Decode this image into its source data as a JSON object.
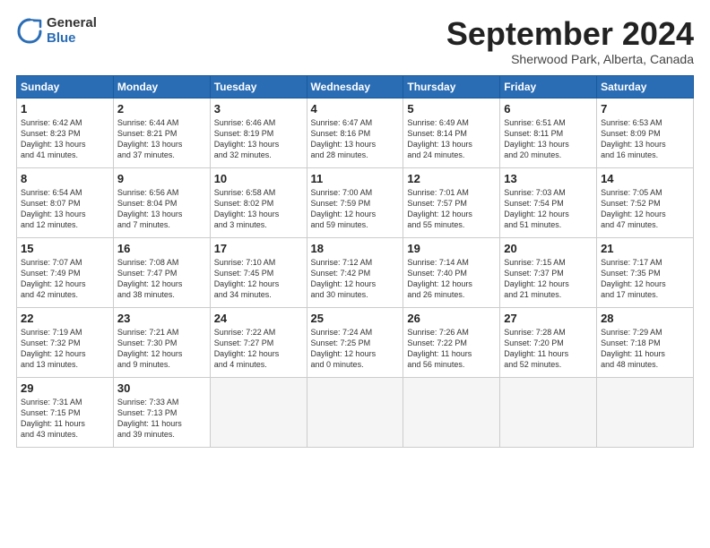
{
  "header": {
    "logo_general": "General",
    "logo_blue": "Blue",
    "month_title": "September 2024",
    "location": "Sherwood Park, Alberta, Canada"
  },
  "days_of_week": [
    "Sunday",
    "Monday",
    "Tuesday",
    "Wednesday",
    "Thursday",
    "Friday",
    "Saturday"
  ],
  "weeks": [
    [
      {
        "day": "1",
        "info": "Sunrise: 6:42 AM\nSunset: 8:23 PM\nDaylight: 13 hours\nand 41 minutes."
      },
      {
        "day": "2",
        "info": "Sunrise: 6:44 AM\nSunset: 8:21 PM\nDaylight: 13 hours\nand 37 minutes."
      },
      {
        "day": "3",
        "info": "Sunrise: 6:46 AM\nSunset: 8:19 PM\nDaylight: 13 hours\nand 32 minutes."
      },
      {
        "day": "4",
        "info": "Sunrise: 6:47 AM\nSunset: 8:16 PM\nDaylight: 13 hours\nand 28 minutes."
      },
      {
        "day": "5",
        "info": "Sunrise: 6:49 AM\nSunset: 8:14 PM\nDaylight: 13 hours\nand 24 minutes."
      },
      {
        "day": "6",
        "info": "Sunrise: 6:51 AM\nSunset: 8:11 PM\nDaylight: 13 hours\nand 20 minutes."
      },
      {
        "day": "7",
        "info": "Sunrise: 6:53 AM\nSunset: 8:09 PM\nDaylight: 13 hours\nand 16 minutes."
      }
    ],
    [
      {
        "day": "8",
        "info": "Sunrise: 6:54 AM\nSunset: 8:07 PM\nDaylight: 13 hours\nand 12 minutes."
      },
      {
        "day": "9",
        "info": "Sunrise: 6:56 AM\nSunset: 8:04 PM\nDaylight: 13 hours\nand 7 minutes."
      },
      {
        "day": "10",
        "info": "Sunrise: 6:58 AM\nSunset: 8:02 PM\nDaylight: 13 hours\nand 3 minutes."
      },
      {
        "day": "11",
        "info": "Sunrise: 7:00 AM\nSunset: 7:59 PM\nDaylight: 12 hours\nand 59 minutes."
      },
      {
        "day": "12",
        "info": "Sunrise: 7:01 AM\nSunset: 7:57 PM\nDaylight: 12 hours\nand 55 minutes."
      },
      {
        "day": "13",
        "info": "Sunrise: 7:03 AM\nSunset: 7:54 PM\nDaylight: 12 hours\nand 51 minutes."
      },
      {
        "day": "14",
        "info": "Sunrise: 7:05 AM\nSunset: 7:52 PM\nDaylight: 12 hours\nand 47 minutes."
      }
    ],
    [
      {
        "day": "15",
        "info": "Sunrise: 7:07 AM\nSunset: 7:49 PM\nDaylight: 12 hours\nand 42 minutes."
      },
      {
        "day": "16",
        "info": "Sunrise: 7:08 AM\nSunset: 7:47 PM\nDaylight: 12 hours\nand 38 minutes."
      },
      {
        "day": "17",
        "info": "Sunrise: 7:10 AM\nSunset: 7:45 PM\nDaylight: 12 hours\nand 34 minutes."
      },
      {
        "day": "18",
        "info": "Sunrise: 7:12 AM\nSunset: 7:42 PM\nDaylight: 12 hours\nand 30 minutes."
      },
      {
        "day": "19",
        "info": "Sunrise: 7:14 AM\nSunset: 7:40 PM\nDaylight: 12 hours\nand 26 minutes."
      },
      {
        "day": "20",
        "info": "Sunrise: 7:15 AM\nSunset: 7:37 PM\nDaylight: 12 hours\nand 21 minutes."
      },
      {
        "day": "21",
        "info": "Sunrise: 7:17 AM\nSunset: 7:35 PM\nDaylight: 12 hours\nand 17 minutes."
      }
    ],
    [
      {
        "day": "22",
        "info": "Sunrise: 7:19 AM\nSunset: 7:32 PM\nDaylight: 12 hours\nand 13 minutes."
      },
      {
        "day": "23",
        "info": "Sunrise: 7:21 AM\nSunset: 7:30 PM\nDaylight: 12 hours\nand 9 minutes."
      },
      {
        "day": "24",
        "info": "Sunrise: 7:22 AM\nSunset: 7:27 PM\nDaylight: 12 hours\nand 4 minutes."
      },
      {
        "day": "25",
        "info": "Sunrise: 7:24 AM\nSunset: 7:25 PM\nDaylight: 12 hours\nand 0 minutes."
      },
      {
        "day": "26",
        "info": "Sunrise: 7:26 AM\nSunset: 7:22 PM\nDaylight: 11 hours\nand 56 minutes."
      },
      {
        "day": "27",
        "info": "Sunrise: 7:28 AM\nSunset: 7:20 PM\nDaylight: 11 hours\nand 52 minutes."
      },
      {
        "day": "28",
        "info": "Sunrise: 7:29 AM\nSunset: 7:18 PM\nDaylight: 11 hours\nand 48 minutes."
      }
    ],
    [
      {
        "day": "29",
        "info": "Sunrise: 7:31 AM\nSunset: 7:15 PM\nDaylight: 11 hours\nand 43 minutes."
      },
      {
        "day": "30",
        "info": "Sunrise: 7:33 AM\nSunset: 7:13 PM\nDaylight: 11 hours\nand 39 minutes."
      },
      {
        "day": "",
        "info": ""
      },
      {
        "day": "",
        "info": ""
      },
      {
        "day": "",
        "info": ""
      },
      {
        "day": "",
        "info": ""
      },
      {
        "day": "",
        "info": ""
      }
    ]
  ]
}
